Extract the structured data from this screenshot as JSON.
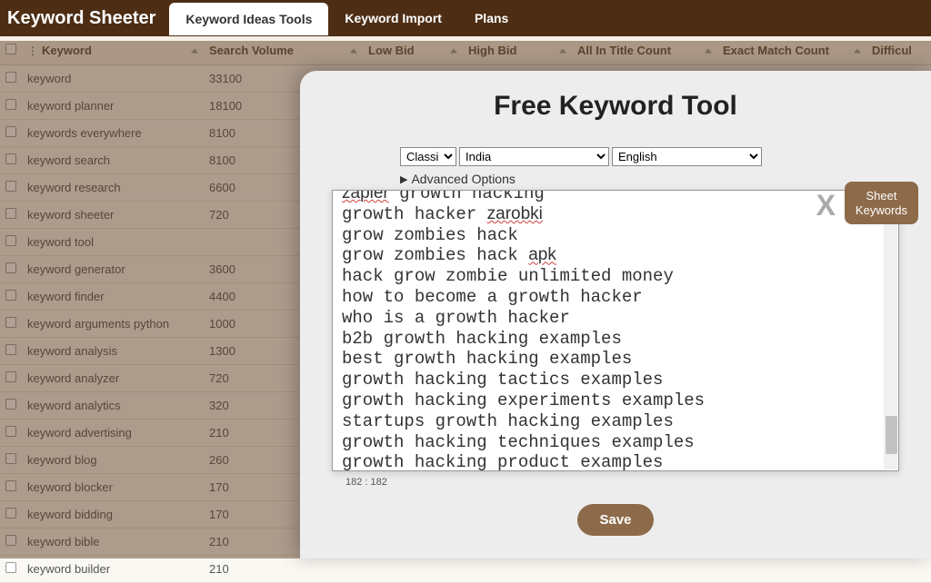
{
  "app": {
    "name": "Keyword Sheeter"
  },
  "nav": [
    {
      "label": "Keyword Ideas Tools",
      "active": true
    },
    {
      "label": "Keyword Import",
      "active": false
    },
    {
      "label": "Plans",
      "active": false
    }
  ],
  "table": {
    "headers": {
      "keyword": "Keyword",
      "search_volume": "Search Volume",
      "low_bid": "Low Bid",
      "high_bid": "High Bid",
      "in_title": "All In Title Count",
      "exact_match": "Exact Match Count",
      "difficulty": "Difficul"
    },
    "rows": [
      {
        "keyword": "keyword",
        "volume": "33100"
      },
      {
        "keyword": "keyword planner",
        "volume": "18100"
      },
      {
        "keyword": "keywords everywhere",
        "volume": "8100"
      },
      {
        "keyword": "keyword search",
        "volume": "8100"
      },
      {
        "keyword": "keyword research",
        "volume": "6600"
      },
      {
        "keyword": "keyword sheeter",
        "volume": "720"
      },
      {
        "keyword": "keyword tool",
        "volume": ""
      },
      {
        "keyword": "keyword generator",
        "volume": "3600"
      },
      {
        "keyword": "keyword finder",
        "volume": "4400"
      },
      {
        "keyword": "keyword arguments python",
        "volume": "1000"
      },
      {
        "keyword": "keyword analysis",
        "volume": "1300"
      },
      {
        "keyword": "keyword analyzer",
        "volume": "720"
      },
      {
        "keyword": "keyword analytics",
        "volume": "320"
      },
      {
        "keyword": "keyword advertising",
        "volume": "210"
      },
      {
        "keyword": "keyword blog",
        "volume": "260"
      },
      {
        "keyword": "keyword blocker",
        "volume": "170"
      },
      {
        "keyword": "keyword bidding",
        "volume": "170"
      },
      {
        "keyword": "keyword bible",
        "volume": "210"
      },
      {
        "keyword": "keyword builder",
        "volume": "210"
      }
    ]
  },
  "modal": {
    "title": "Free Keyword Tool",
    "mode": "Classic",
    "country": "India",
    "language": "English",
    "advanced": "Advanced Options",
    "close": "X",
    "sheet_btn_l1": "Sheet",
    "sheet_btn_l2": "Keywords",
    "counter": "182 : 182",
    "save": "Save",
    "results": [
      "zapier growth hacking",
      "growth hacker zarobki",
      "grow zombies hack",
      "grow zombies hack apk",
      "hack grow zombie unlimited money",
      "how to become a growth hacker",
      "who is a growth hacker",
      "b2b growth hacking examples",
      "best growth hacking examples",
      "growth hacking tactics examples",
      "growth hacking experiments examples",
      "startups growth hacking examples",
      "growth hacking techniques examples",
      "growth hacking product examples"
    ]
  }
}
